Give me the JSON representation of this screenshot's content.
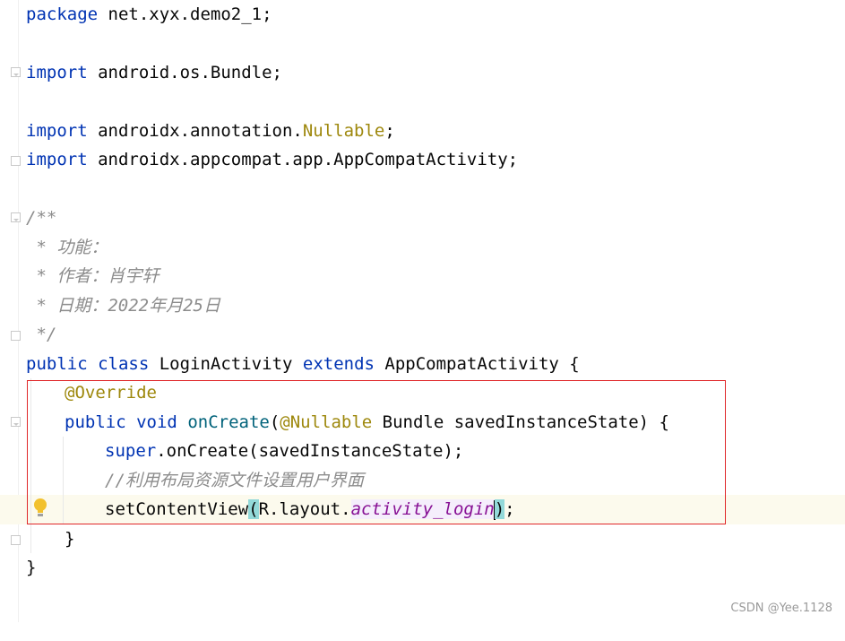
{
  "code": {
    "line_package": {
      "kw": "package",
      "rest": " net.xyx.demo2_1;"
    },
    "line_import1": {
      "kw": "import",
      "rest": " android.os.Bundle;"
    },
    "line_import2": {
      "kw": "import",
      "rest": " androidx.annotation.",
      "ann": "Nullable",
      "end": ";"
    },
    "line_import3": {
      "kw": "import",
      "rest": " androidx.appcompat.app.AppCompatActivity;"
    },
    "doc": {
      "open": "/**",
      "l1": " * 功能：",
      "l2": " * 作者：肖宇轩",
      "l3": " * 日期：2022年月25日",
      "close": " */"
    },
    "class_decl": {
      "kw1": "public",
      "kw2": "class",
      "name": " LoginActivity ",
      "kw3": "extends",
      "rest": " AppCompatActivity {"
    },
    "override": "@Override",
    "method_decl": {
      "kw1": "public",
      "kw2": "void",
      "fn": "onCreate",
      "p_open": "(",
      "ann": "@Nullable",
      "rest": " Bundle savedInstanceState) {"
    },
    "super_call": {
      "kw": "super",
      "rest": ".onCreate(savedInstanceState);"
    },
    "comment": "//利用布局资源文件设置用户界面",
    "set_content": {
      "fn": "setContentView",
      "p_open": "(",
      "mid": "R.layout.",
      "field": "activity_login",
      "p_close": ")",
      "end": ";"
    },
    "close_method": "}",
    "close_class": "}"
  },
  "watermark": "CSDN @Yee.1128"
}
